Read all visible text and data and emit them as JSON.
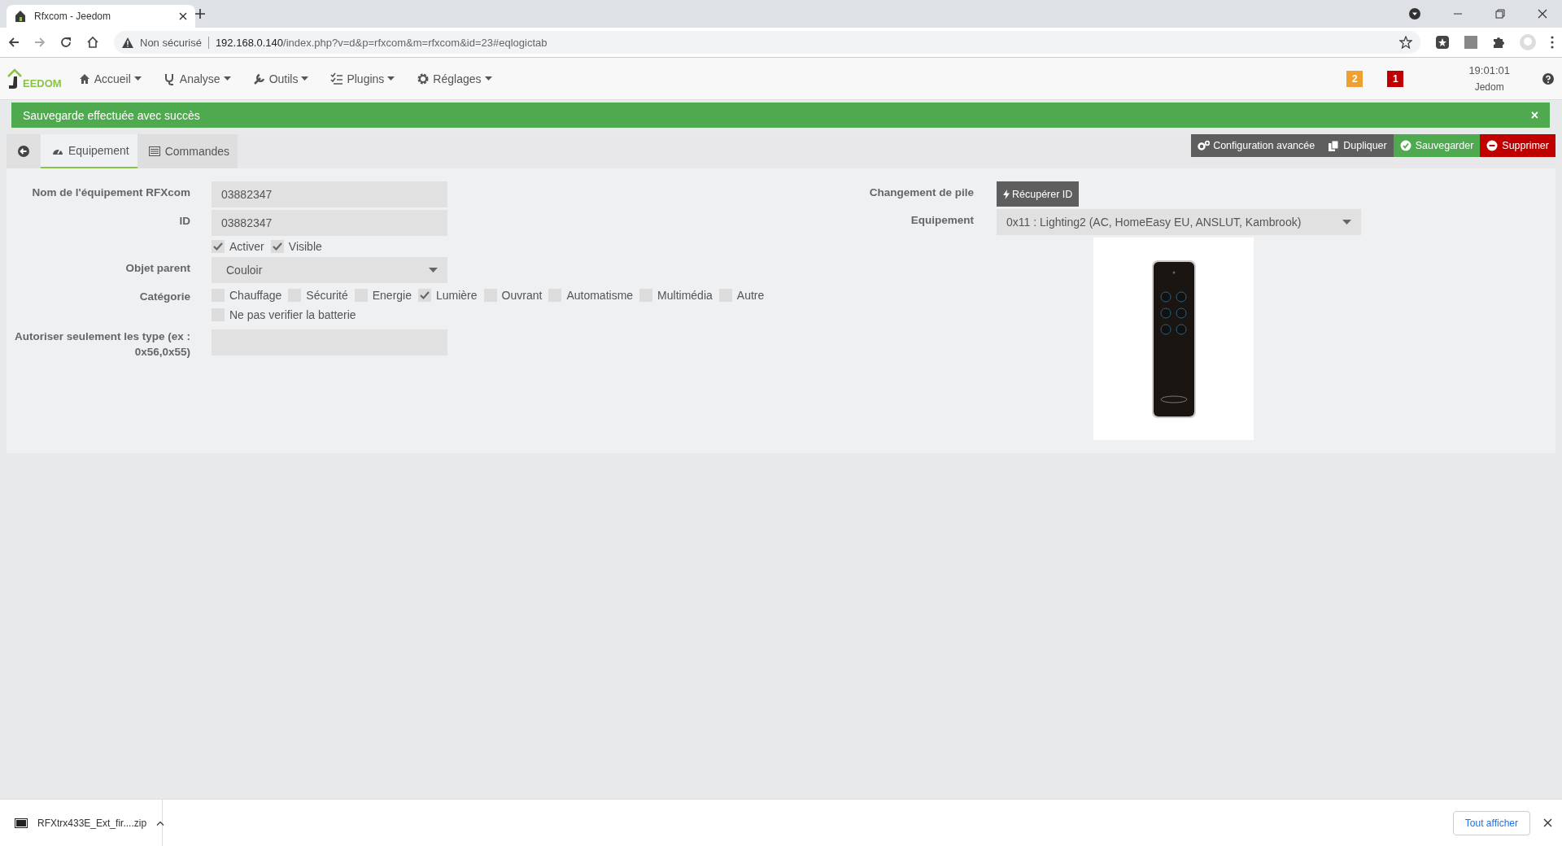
{
  "browser": {
    "tab_title": "Rfxcom - Jeedom",
    "security": "Non sécurisé",
    "url_host": "192.168.0.140",
    "url_path": "/index.php?v=d&p=rfxcom&m=rfxcom&id=23#eqlogictab"
  },
  "navbar": {
    "logo": "EEDOM",
    "menus": [
      {
        "label": "Accueil",
        "kind": "home"
      },
      {
        "label": "Analyse",
        "kind": "analyse"
      },
      {
        "label": "Outils",
        "kind": "tools"
      },
      {
        "label": "Plugins",
        "kind": "plugins"
      },
      {
        "label": "Réglages",
        "kind": "settings"
      }
    ],
    "badges": [
      {
        "text": "2",
        "color": "#f0a030"
      },
      {
        "text": "1",
        "color": "#c00000"
      }
    ],
    "time": "19:01:01",
    "user": "Jedom"
  },
  "alert": {
    "message": "Sauvegarde effectuée avec succès",
    "close": "×"
  },
  "tabs": [
    {
      "label": "Equipement",
      "kind": "equipment",
      "selected": true
    },
    {
      "label": "Commandes",
      "kind": "commands",
      "selected": false
    }
  ],
  "actions": [
    {
      "label": "Configuration avancée",
      "kind": "config"
    },
    {
      "label": "Dupliquer",
      "kind": "duplicate"
    },
    {
      "label": "Sauvegarder",
      "kind": "save"
    },
    {
      "label": "Supprimer",
      "kind": "delete"
    }
  ],
  "form_left": [
    {
      "kind": "text",
      "label": "Nom de l'équipement RFXcom",
      "value": "03882347"
    },
    {
      "kind": "text",
      "label": "ID",
      "value": "03882347"
    },
    {
      "kind": "checks",
      "options": [
        {
          "label": "Activer",
          "checked": true
        },
        {
          "label": "Visible",
          "checked": true
        }
      ]
    },
    {
      "kind": "select",
      "label": "Objet parent",
      "value": "Couloir"
    },
    {
      "kind": "checks",
      "label": "Catégorie",
      "options": [
        {
          "label": "Chauffage",
          "checked": false
        },
        {
          "label": "Sécurité",
          "checked": false
        },
        {
          "label": "Energie",
          "checked": false
        },
        {
          "label": "Lumière",
          "checked": true
        },
        {
          "label": "Ouvrant",
          "checked": false
        },
        {
          "label": "Automatisme",
          "checked": false
        },
        {
          "label": "Multimédia",
          "checked": false
        },
        {
          "label": "Autre",
          "checked": false
        }
      ]
    },
    {
      "kind": "checks",
      "options": [
        {
          "label": "Ne pas verifier la batterie",
          "checked": false
        }
      ]
    },
    {
      "kind": "text",
      "label": "Autoriser seulement les type (ex : 0x56,0x55)"
    }
  ],
  "form_right": [
    {
      "kind": "button",
      "label": "Changement de pile",
      "button": "Récupérer ID"
    },
    {
      "kind": "select",
      "label": "Equipement",
      "value": "0x11 : Lighting2 (AC, HomeEasy EU, ANSLUT, Kambrook)"
    },
    {
      "kind": "image"
    }
  ],
  "downloads": {
    "file": "RFXtrx433E_Ext_fir....zip",
    "show_all": "Tout afficher"
  }
}
